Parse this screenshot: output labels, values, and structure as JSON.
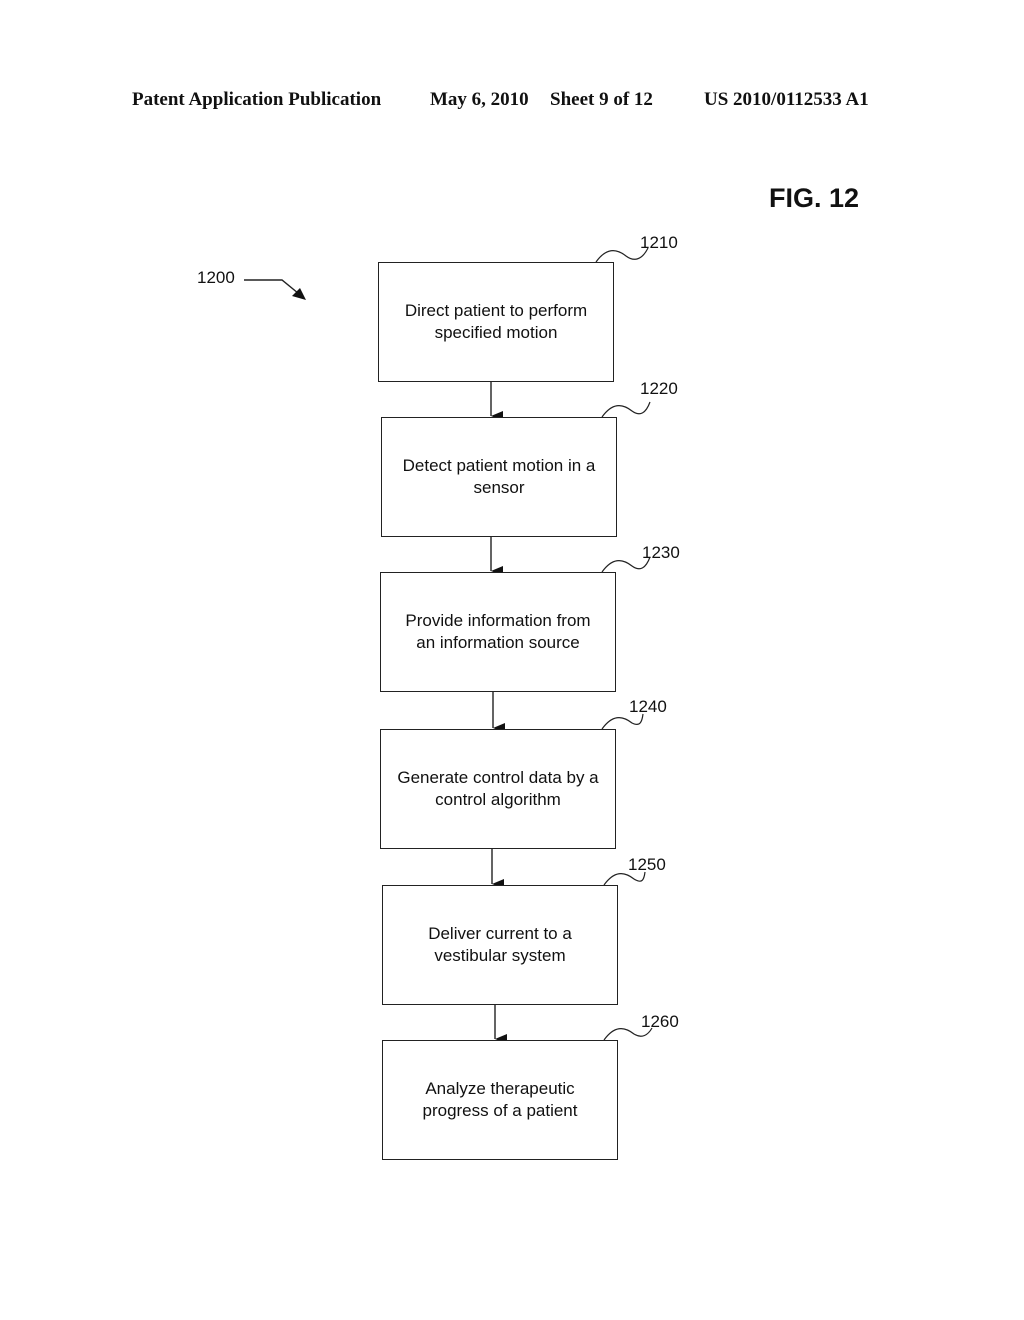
{
  "header": {
    "publication": "Patent Application Publication",
    "date": "May 6, 2010",
    "sheet": "Sheet 9 of 12",
    "number": "US 2010/0112533 A1"
  },
  "figure": {
    "label": "FIG. 12",
    "reference": "1200"
  },
  "steps": [
    {
      "ref": "1210",
      "line1": "Direct patient to perform",
      "line2": "specified motion"
    },
    {
      "ref": "1220",
      "line1": "Detect patient motion in a",
      "line2": "sensor"
    },
    {
      "ref": "1230",
      "line1": "Provide information from",
      "line2": "an information source"
    },
    {
      "ref": "1240",
      "line1": "Generate control data by a",
      "line2": "control algorithm"
    },
    {
      "ref": "1250",
      "line1": "Deliver current to a",
      "line2": "vestibular system"
    },
    {
      "ref": "1260",
      "line1": "Analyze therapeutic",
      "line2": "progress of a patient"
    }
  ]
}
